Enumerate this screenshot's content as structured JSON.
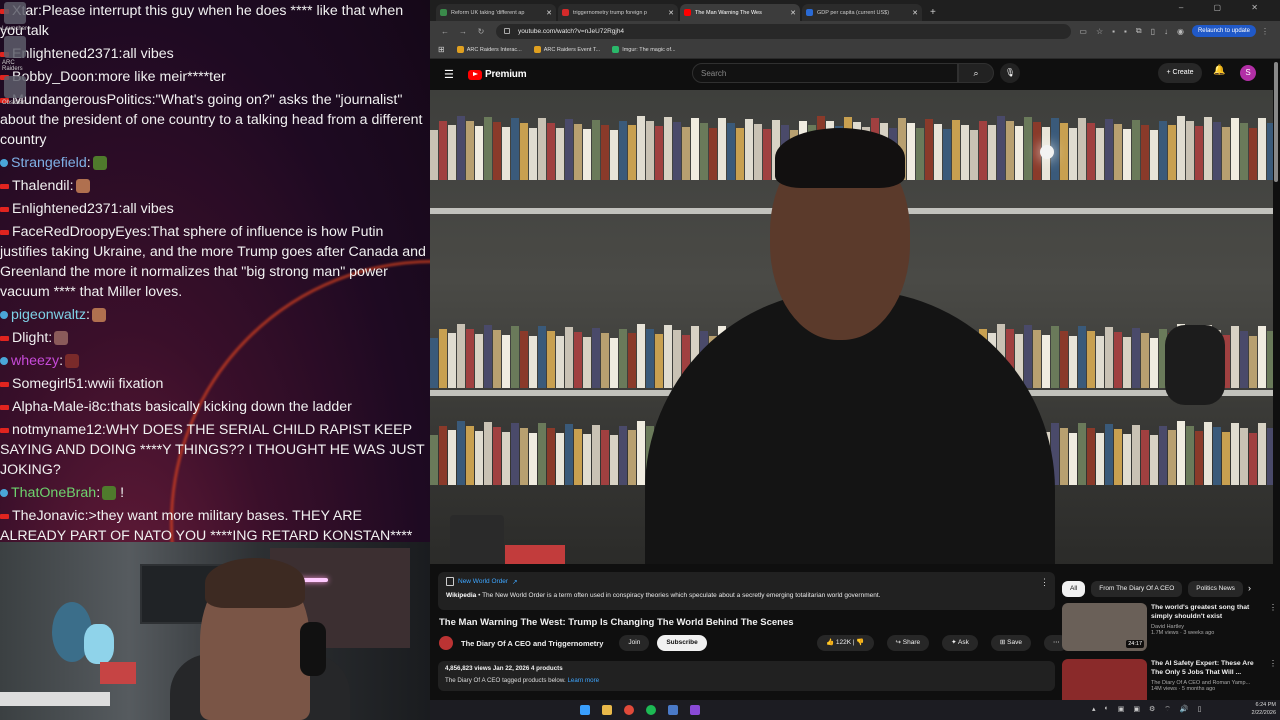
{
  "chat": {
    "messages": [
      {
        "badge": "red",
        "user": "Xtar",
        "text": "Please interrupt this guy when he does **** like that when you talk",
        "user_color": "#f1f1f1"
      },
      {
        "badge": "red",
        "user": "Enlightened2371",
        "text": "all vibes",
        "user_color": "#f1f1f1"
      },
      {
        "badge": "red",
        "user": "Bobby_Doon",
        "text": "more like meir****ter",
        "user_color": "#f1f1f1"
      },
      {
        "badge": "red",
        "user": "MundangerousPolitics",
        "text": "\"What's going on?\" asks the \"journalist\" about the president of one country to a talking head from a different country",
        "user_color": "#f1f1f1"
      },
      {
        "badge": "blue",
        "user": "Strangefield",
        "text": "",
        "user_color": "#7fb0e6",
        "emote": "#4f7a2c"
      },
      {
        "badge": "red",
        "user": "Thalendil",
        "text": "",
        "user_color": "#f1f1f1",
        "emote": "#b0704f"
      },
      {
        "badge": "red",
        "user": "Enlightened2371",
        "text": "all vibes",
        "user_color": "#f1f1f1"
      },
      {
        "badge": "red",
        "user": "FaceRedDroopyEyes",
        "text": "That sphere of influence is how Putin justifies taking Ukraine, and the more Trump goes after Canada and Greenland the more it normalizes that \"big strong man\" power vacuum **** that Miller loves.",
        "user_color": "#f1f1f1"
      },
      {
        "badge": "blue",
        "user": "pigeonwaltz",
        "text": "",
        "user_color": "#7fd1e6",
        "emote": "#b0704f"
      },
      {
        "badge": "red",
        "user": "Dlight",
        "text": "",
        "user_color": "#f1f1f1",
        "emote": "#8a5a5a"
      },
      {
        "badge": "blue",
        "user": "wheezy",
        "text": "",
        "user_color": "#c64ad8",
        "emote": "#7a2a2a"
      },
      {
        "badge": "red",
        "user": "Somegirl51",
        "text": "wwii fixation",
        "user_color": "#f1f1f1"
      },
      {
        "badge": "red",
        "user": "Alpha-Male-i8c",
        "text": "thats basically kicking down the ladder",
        "user_color": "#f1f1f1"
      },
      {
        "badge": "red",
        "user": "notmyname12",
        "text": "WHY DOES THE SERIAL CHILD RAPIST KEEP SAYING AND DOING ****Y THINGS?? I THOUGHT HE WAS JUST JOKING?",
        "user_color": "#f1f1f1"
      },
      {
        "badge": "blue",
        "user": "ThatOneBrah",
        "text": " !",
        "user_color": "#6ed36e",
        "emote": "#4f7a2c"
      },
      {
        "badge": "red",
        "user": "TheJonavic",
        "text": ">they want more military bases. THEY ARE ALREADY PART OF NATO YOU ****ING RETARD KONSTAN****",
        "user_color": "#f1f1f1"
      }
    ],
    "desktop_icons": [
      "Launcher",
      "ARC Raiders",
      "Obsidian"
    ]
  },
  "browser": {
    "tabs": [
      {
        "label": "Reform UK taking 'different ap",
        "active": false,
        "color": "#3a8a4a"
      },
      {
        "label": "triggernometry trump foreign p",
        "active": false,
        "color": "#d42a2a"
      },
      {
        "label": "The Man Warning The Wes",
        "active": true,
        "color": "#ff0000"
      },
      {
        "label": "GDP per capita (current US$)",
        "active": false,
        "color": "#2a6ad4"
      }
    ],
    "new_tab": "+",
    "url": "youtube.com/watch?v=nJeU72Rgjh4",
    "relaunch_label": "Relaunch to update",
    "bookmarks": [
      {
        "label": "ARC Raiders Interac...",
        "color": "#e0a020"
      },
      {
        "label": "ARC Raiders Event T...",
        "color": "#e0a020"
      },
      {
        "label": "Imgur: The magic of...",
        "color": "#2ab86a"
      }
    ]
  },
  "youtube": {
    "logo": "Premium",
    "search_placeholder": "Search",
    "create_label": "Create",
    "avatar_letter": "S",
    "info_panel": {
      "title": "New World Order",
      "source": "Wikipedia",
      "text": "The New World Order is a term often used in conspiracy theories which speculate about a secretly emerging totalitarian world government."
    },
    "video_title": "The Man Warning The West: Trump Is Changing The World Behind The Scenes",
    "channel": "The Diary Of A CEO and Triggernometry",
    "join_label": "Join",
    "subscribe_label": "Subscribe",
    "likes": "122K",
    "share_label": "Share",
    "ask_label": "Ask",
    "save_label": "Save",
    "meta_line": "4,856,823 views  Jan 22, 2026  4 products",
    "meta_sub": "The Diary Of A CEO tagged products below.",
    "learn_more": "Learn more",
    "chips": [
      {
        "label": "All",
        "active": true
      },
      {
        "label": "From The Diary Of A CEO",
        "active": false
      },
      {
        "label": "Politics News",
        "active": false
      }
    ],
    "recommendations": [
      {
        "title": "The world's greatest song that simply shouldn't exist",
        "channel": "David Hartley",
        "views": "1.7M views · 3 weeks ago",
        "duration": "24:17",
        "thumb": "#6a6058"
      },
      {
        "title": "The AI Safety Expert: These Are The Only 5 Jobs That Will ...",
        "channel": "The Diary Of A CEO and Roman Yamp...",
        "views": "14M views · 5 months ago",
        "duration": "",
        "thumb": "#8a2a2a"
      }
    ]
  },
  "taskbar": {
    "time": "6:24 PM",
    "date": "2/22/2026"
  }
}
